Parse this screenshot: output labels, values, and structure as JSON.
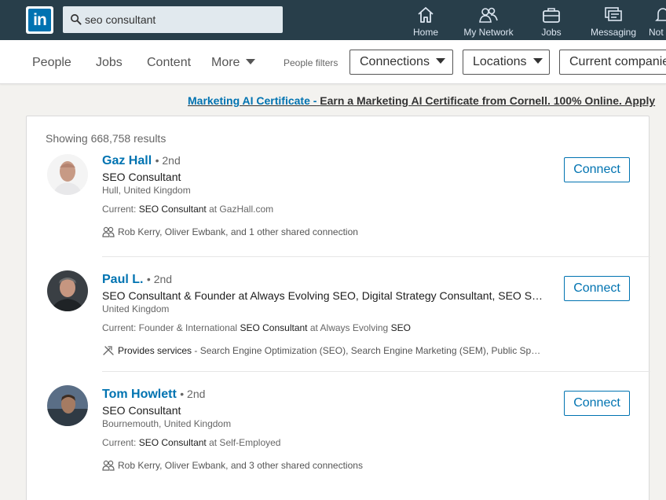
{
  "search": {
    "value": "seo consultant"
  },
  "nav": [
    {
      "label": "Home"
    },
    {
      "label": "My Network"
    },
    {
      "label": "Jobs"
    },
    {
      "label": "Messaging"
    },
    {
      "label": "Not"
    }
  ],
  "filters": {
    "tabs": [
      "People",
      "Jobs",
      "Content",
      "More"
    ],
    "people_filters_label": "People filters",
    "buttons": [
      "Connections",
      "Locations",
      "Current companies"
    ]
  },
  "ad": {
    "link": "Marketing AI Certificate -",
    "text": "Earn a Marketing AI Certificate from Cornell. 100% Online. Apply"
  },
  "results": {
    "count_label": "Showing 668,758 results",
    "connect_label": "Connect",
    "items": [
      {
        "name": "Gaz Hall",
        "degree": "• 2nd",
        "headline": "SEO Consultant",
        "location": "Hull, United Kingdom",
        "current_prefix": "Current:",
        "current_bold": "SEO Consultant",
        "current_rest": "at GazHall.com",
        "meta_strong": "",
        "meta": "Rob Kerry, Oliver Ewbank, and 1 other shared connection",
        "meta_icon": "shared-connections-icon"
      },
      {
        "name": "Paul L.",
        "degree": "• 2nd",
        "headline": "SEO Consultant & Founder at Always Evolving SEO, Digital Strategy Consultant, SEO Speaker",
        "location": "United Kingdom",
        "current_prefix": "Current: Founder & International",
        "current_bold": "SEO Consultant",
        "current_rest": "at Always Evolving",
        "current_bold2": "SEO",
        "meta_strong": "Provides services",
        "meta": "- Search Engine Optimization (SEO), Search Engine Marketing (SEM), Public Speaking",
        "meta_icon": "services-icon"
      },
      {
        "name": "Tom Howlett",
        "degree": "• 2nd",
        "headline": "SEO Consultant",
        "location": "Bournemouth, United Kingdom",
        "current_prefix": "Current:",
        "current_bold": "SEO Consultant",
        "current_rest": "at Self-Employed",
        "meta_strong": "",
        "meta": "Rob Kerry, Oliver Ewbank, and 3 other shared connections",
        "meta_icon": "shared-connections-icon"
      }
    ]
  },
  "colors": {
    "topbar": "#283e4a",
    "brand": "#0073b1"
  }
}
